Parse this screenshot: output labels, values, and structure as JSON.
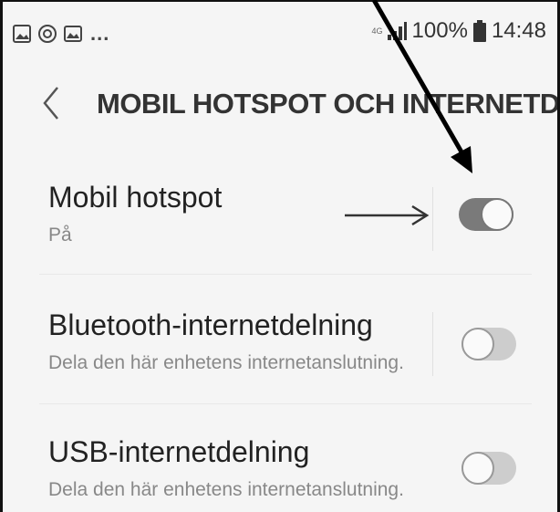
{
  "status_bar": {
    "left_icons": [
      "image-icon",
      "sync-icon",
      "gallery-icon"
    ],
    "overflow": "...",
    "network_type": "4G",
    "battery": "100%",
    "time": "14:48"
  },
  "header": {
    "back_icon": "chevron-left-icon",
    "title": "MOBIL HOTSPOT OCH INTERNETDELNING"
  },
  "settings": [
    {
      "title": "Mobil hotspot",
      "subtitle": "På",
      "toggle": true
    },
    {
      "title": "Bluetooth-internetdelning",
      "subtitle": "Dela den här enhetens internetanslutning.",
      "toggle": false
    },
    {
      "title": "USB-internetdelning",
      "subtitle": "Dela den här enhetens internetanslutning.",
      "toggle": false
    }
  ],
  "annotations": {
    "pointer_arrow": "diagonal-arrow-icon",
    "side_arrow": "right-arrow-icon"
  },
  "colors": {
    "background": "#f5f5f5",
    "toggle_on": "#7a7a7a",
    "toggle_off": "#cdcdcd",
    "text_primary": "#222222",
    "text_secondary": "#888888"
  }
}
